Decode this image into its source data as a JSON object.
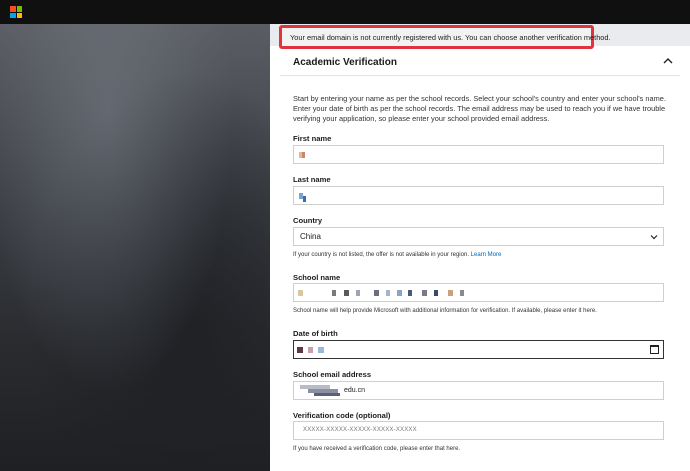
{
  "banner": {
    "message": "Your email domain is not currently registered with us. You can choose another verification method."
  },
  "section": {
    "title": "Academic Verification",
    "expand_icon": "chevron-up-icon"
  },
  "intro": "Start by entering your name as per the school records. Select your school's country and enter your school's name. Enter your date of birth as per the school records. The email address may be used to reach you if we have trouble verifying your application, so please enter your school provided email address.",
  "fields": {
    "first_name": {
      "label": "First name"
    },
    "last_name": {
      "label": "Last name"
    },
    "country": {
      "label": "Country",
      "value": "China",
      "help": "If your country is not listed, the offer is not available in your region.",
      "help_link": "Learn More"
    },
    "school_name": {
      "label": "School name",
      "help": "School name will help provide Microsoft with additional information for verification. If available, please enter it here."
    },
    "date_of_birth": {
      "label": "Date of birth"
    },
    "school_email": {
      "label": "School email address",
      "value_suffix": "edu.cn"
    },
    "verification_code": {
      "label": "Verification code (optional)",
      "placeholder": "XXXXX-XXXXX-XXXXX-XXXXX-XXXXX",
      "help": "If you have received a verification code, please enter that here."
    }
  },
  "colors": {
    "highlight": "#e0333b",
    "link": "#0067b8"
  }
}
